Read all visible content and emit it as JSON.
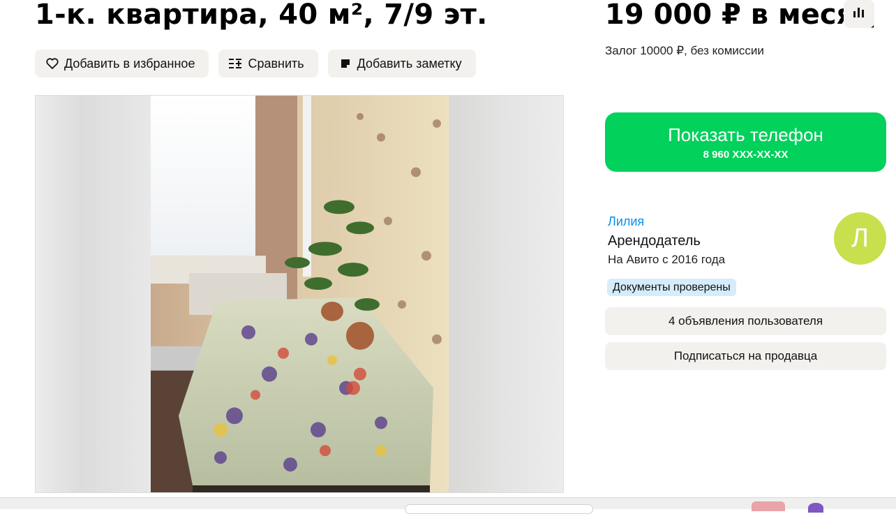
{
  "listing": {
    "title": "1-к. квартира, 40 м², 7/9 эт.",
    "price": "19 000 ₽ в месяц",
    "deposit": "Залог 10000 ₽, без комиссии"
  },
  "actions": {
    "favorite_label": "Добавить в избранное",
    "compare_label": "Сравнить",
    "note_label": "Добавить заметку"
  },
  "contact": {
    "show_phone_label": "Показать телефон",
    "phone_masked": "8 960 XXX-XX-XX"
  },
  "seller": {
    "name": "Лилия",
    "role": "Арендодатель",
    "since": "На Авито с 2016 года",
    "avatar_letter": "Л",
    "badge": "Документы проверены",
    "listings_label": "4 объявления пользователя",
    "subscribe_label": "Подписаться на продавца"
  },
  "colors": {
    "accent_green": "#02d15c",
    "link_blue": "#0a8ee8",
    "avatar_bg": "#c8e04d",
    "button_bg": "#f2f1ee",
    "badge_bg": "#d6ecfb"
  }
}
